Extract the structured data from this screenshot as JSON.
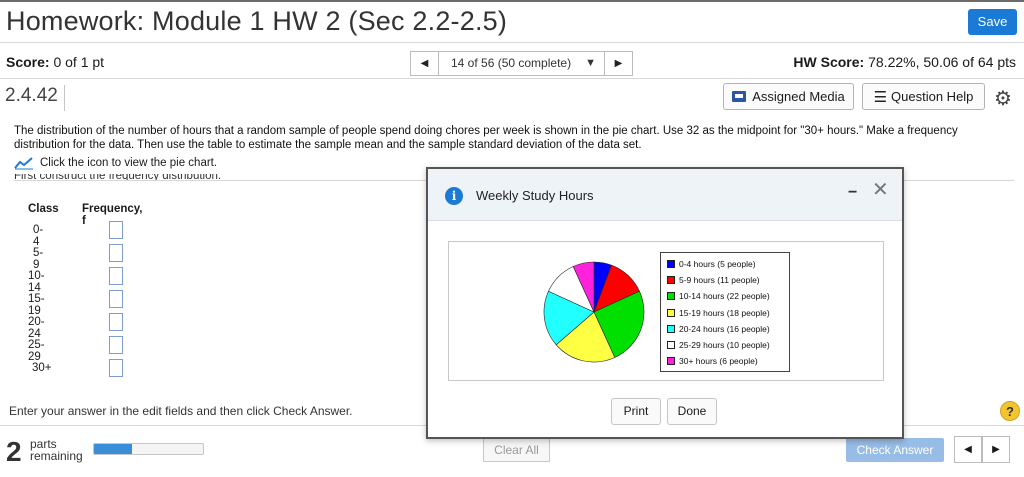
{
  "header": {
    "title": "Homework: Module 1 HW 2 (Sec 2.2-2.5)",
    "save_label": "Save"
  },
  "scorebar": {
    "score_label": "Score:",
    "score_value": "0 of 1 pt",
    "question_select": "14 of 56 (50 complete)",
    "hw_score_label": "HW Score:",
    "hw_score_value": "78.22%, 50.06 of 64 pts"
  },
  "question": {
    "number": "2.4.42",
    "assigned_media": "Assigned Media",
    "question_help": "Question Help",
    "text": "The distribution of the number of hours that a random sample of people spend doing chores per week is shown in the pie chart. Use 32 as the midpoint for \"30+ hours.\" Make a frequency distribution for the data. Then use the table to estimate the sample mean and the sample standard deviation of the data set.",
    "chart_link": "Click the icon to view the pie chart.",
    "obscured_text": "First construct the frequency distribution."
  },
  "table": {
    "col_class": "Class",
    "col_freq": "Frequency, f",
    "classes": [
      "0-4",
      "5-9",
      "10-14",
      "15-19",
      "20-24",
      "25-29",
      "30+"
    ]
  },
  "footer": {
    "instruction": "Enter your answer in the edit fields and then click Check Answer.",
    "help_glyph": "?",
    "parts_count": "2",
    "parts_word": "parts",
    "remaining_word": "remaining",
    "progress_fraction": 0.35,
    "clear_all": "Clear All",
    "check_answer": "Check Answer"
  },
  "modal": {
    "info_glyph": "i",
    "title": "Weekly Study Hours",
    "print_label": "Print",
    "done_label": "Done"
  },
  "chart_data": {
    "type": "pie",
    "title": "",
    "legend_position": "right",
    "slices": [
      {
        "label": "0-4 hours (5 people)",
        "value": 5,
        "color": "#0000ff"
      },
      {
        "label": "5-9 hours (11 people)",
        "value": 11,
        "color": "#ff0000"
      },
      {
        "label": "10-14 hours (22 people)",
        "value": 22,
        "color": "#00e000"
      },
      {
        "label": "15-19 hours (18 people)",
        "value": 18,
        "color": "#ffff44"
      },
      {
        "label": "20-24 hours (16 people)",
        "value": 16,
        "color": "#22ffff"
      },
      {
        "label": "25-29 hours (10 people)",
        "value": 10,
        "color": "#ffffff"
      },
      {
        "label": "30+ hours (6 people)",
        "value": 6,
        "color": "#ff22dd"
      }
    ]
  }
}
